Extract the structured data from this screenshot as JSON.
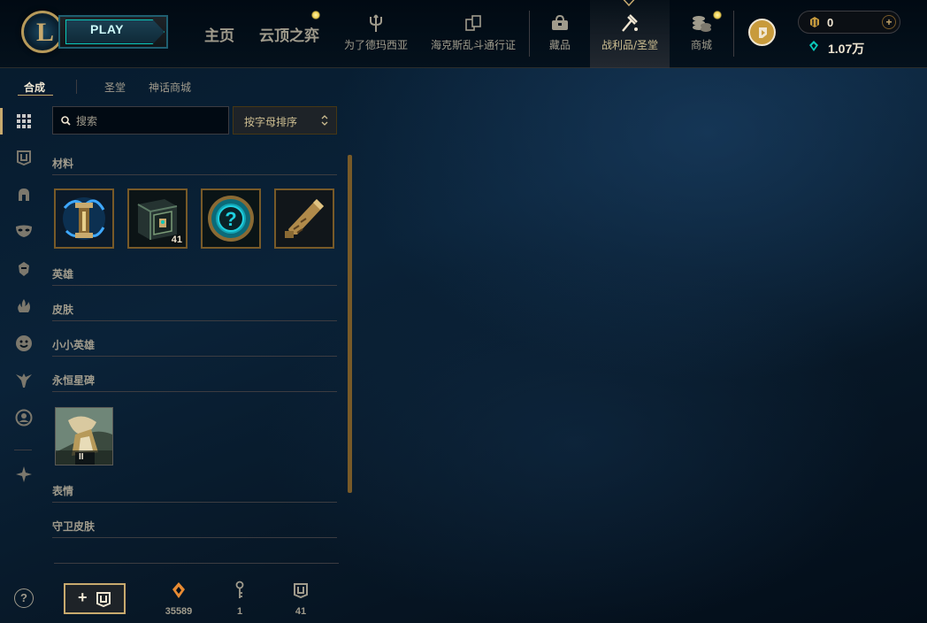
{
  "topbar": {
    "play_label": "PLAY",
    "nav_home": "主页",
    "nav_tft": "云顶之弈",
    "nav_items": [
      {
        "label": "为了德玛西亚",
        "icon": "trident-icon"
      },
      {
        "label": "海克斯乱斗通行证",
        "icon": "cards-icon"
      },
      {
        "label": "藏品",
        "icon": "collection-bag-icon"
      },
      {
        "label": "战利品/圣堂",
        "icon": "loot-hammer-icon"
      },
      {
        "label": "商城",
        "icon": "store-coins-icon"
      }
    ],
    "active_nav": "战利品/圣堂",
    "rp_value": "0",
    "be_value": "1.07万"
  },
  "subtabs": [
    {
      "label": "合成",
      "active": true
    },
    {
      "label": "圣堂",
      "active": false
    },
    {
      "label": "神话商城",
      "active": false
    }
  ],
  "rail": {
    "icons": [
      "grid-icon",
      "chest-icon",
      "helmet-icon",
      "mask-icon",
      "champion-icon",
      "flame-icon",
      "emote-icon",
      "ward-icon",
      "profile-icon",
      "eternals-icon"
    ]
  },
  "search": {
    "placeholder": "搜索",
    "value": ""
  },
  "sort": {
    "label": "按字母排序"
  },
  "categories": {
    "materials": "材料",
    "champions": "英雄",
    "skins": "皮肤",
    "little_legends": "小小英雄",
    "eternals": "永恒星碑",
    "emotes": "表情",
    "ward_skins": "守卫皮肤"
  },
  "materials": [
    {
      "name": "hextech-chest-icon",
      "count": ""
    },
    {
      "name": "masterwork-chest-icon",
      "count": "41"
    },
    {
      "name": "mystery-orb-icon",
      "count": ""
    },
    {
      "name": "hextech-key-icon",
      "count": ""
    }
  ],
  "eternals_items": [
    {
      "name": "eternal-series-icon",
      "badge": "II"
    }
  ],
  "footer": {
    "help_label": "?",
    "add_chest_label": "+",
    "stats": [
      {
        "icon": "orange-essence-icon",
        "value": "35589"
      },
      {
        "icon": "key-icon",
        "value": "1"
      },
      {
        "icon": "chest-icon",
        "value": "41"
      }
    ]
  },
  "colors": {
    "gold": "#c8aa6e",
    "gold_dark": "#785a28",
    "text_muted": "#a09b8c",
    "text_light": "#f0e6d2",
    "blue_essence": "#0ac8b9",
    "orange_essence": "#e88b33"
  }
}
